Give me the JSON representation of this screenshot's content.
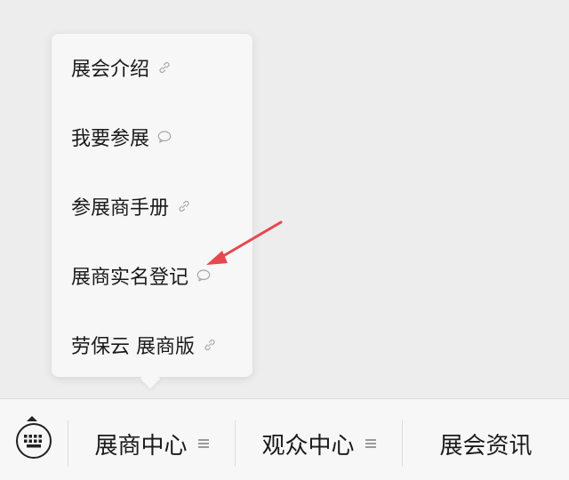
{
  "submenu": {
    "items": [
      {
        "label": "展会介绍",
        "icon": "link-icon"
      },
      {
        "label": "我要参展",
        "icon": "chat-bubble-icon"
      },
      {
        "label": "参展商手册",
        "icon": "link-icon"
      },
      {
        "label": "展商实名登记",
        "icon": "chat-bubble-icon"
      },
      {
        "label": "劳保云 展商版",
        "icon": "link-icon"
      }
    ]
  },
  "bottom_bar": {
    "keyboard_icon": "keyboard-icon",
    "tabs": [
      {
        "label": "展商中心",
        "has_submenu": true
      },
      {
        "label": "观众中心",
        "has_submenu": true
      },
      {
        "label": "展会资讯",
        "has_submenu": false
      }
    ]
  },
  "colors": {
    "background": "#ededed",
    "panel": "#f7f7f7",
    "text": "#1a1a1a",
    "icon_gray": "#9a9a9a",
    "annotation_red": "#e5484d"
  }
}
